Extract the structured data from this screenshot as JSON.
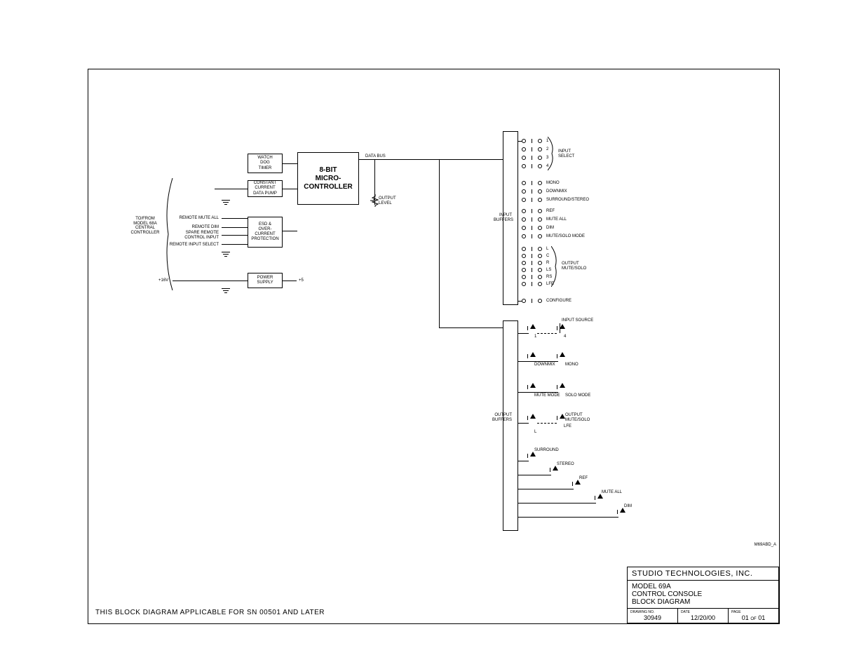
{
  "applicable": "THIS BLOCK DIAGRAM APPLICABLE FOR SN 00501 AND LATER",
  "file_id": "M69ABD_A",
  "titleblock": {
    "company": "STUDIO TECHNOLOGIES, INC.",
    "l1": "MODEL 69A",
    "l2": "CONTROL CONSOLE",
    "l3": "BLOCK DIAGRAM",
    "h_dwg": "DRAWING NO.",
    "v_dwg": "30949",
    "h_date": "DATE",
    "v_date": "12/20/00",
    "h_page": "PAGE",
    "v_page_a": "01",
    "v_page_of": "OF",
    "v_page_b": "01"
  },
  "blocks": {
    "wdt": "WATCH\nDOG\nTIMER",
    "ccdp": "CONSTANT\nCURRENT\nDATA PUMP",
    "esd": "ESD &\nOVER-\nCURRENT\nPROTECTION",
    "psu": "POWER\nSUPPLY",
    "mcu": "8-BIT\nMICRO-\nCONTROLLER",
    "inbuf": "INPUT\nBUFFERS",
    "outbuf": "OUTPUT\nBUFFERS"
  },
  "labels": {
    "tofrom": "TO/FROM\nMODEL 68A\nCENTRAL\nCONTROLLER",
    "rma": "REMOTE MUTE ALL",
    "rdim": "REMOTE DIM",
    "spare": "SPARE REMOTE\nCONTROL INPUT",
    "ris": "REMOTE INPUT SELECT",
    "v16": "+16V",
    "v5": "+5",
    "databus": "DATA BUS",
    "outlvl": "OUTPUT\nLEVEL",
    "inputselect": "INPUT\nSELECT",
    "outmutesolo": "OUTPUT\nMUTE/SOLO",
    "mono": "MONO",
    "downmix": "DOWNMIX",
    "surrst": "SURROUND/STEREO",
    "ref": "REF",
    "muteall": "MUTE ALL",
    "dim": "DIM",
    "msmode": "MUTE/SOLO MODE",
    "configure": "CONFIGURE",
    "ch_l": "L",
    "ch_c": "C",
    "ch_r": "R",
    "ch_ls": "LS",
    "ch_rs": "RS",
    "ch_lfe": "LFE",
    "n1": "1",
    "n2": "2",
    "n3": "3",
    "n4": "4",
    "insrc": "INPUT SOURCE",
    "led_1": "1",
    "led_4": "4",
    "led_downmix": "DOWNMIX",
    "led_mono": "MONO",
    "led_mutemode": "MUTE MODE",
    "led_solomode": "SOLO MODE",
    "led_omsl": "OUTPUT\nMUTE/SOLO",
    "led_l": "L",
    "led_lfe": "LFE",
    "led_surround": "SURROUND",
    "led_stereo": "STEREO",
    "led_ref": "REF",
    "led_muteall": "MUTE ALL",
    "led_dim": "DIM"
  }
}
